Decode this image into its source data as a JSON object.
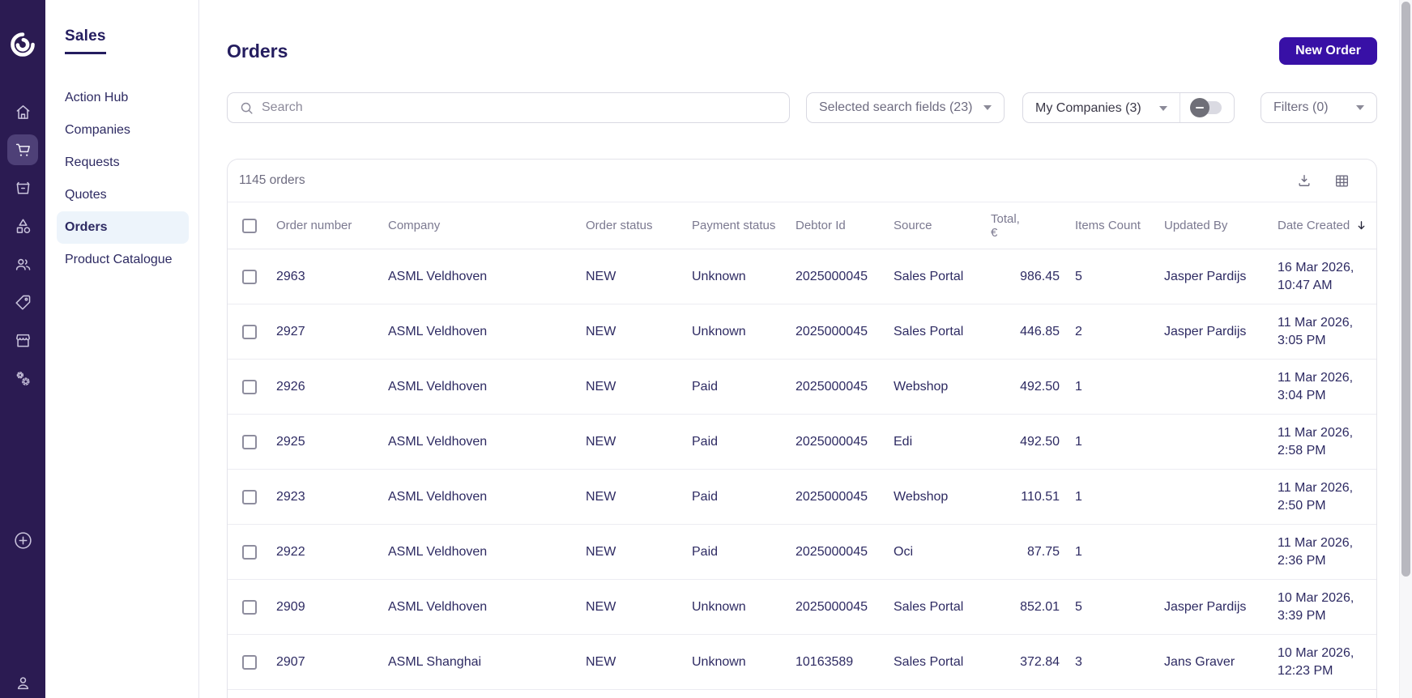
{
  "colors": {
    "rail_bg": "#2b1b52",
    "rail_selected_bg": "#4e4077",
    "accent_button": "#3810a6",
    "active_nav_bg": "#edf4fb",
    "text_dark": "#2d2a62",
    "text_muted": "#6e6c80",
    "header_gray": "#7b7990",
    "border": "#e3e3ea"
  },
  "rail": {
    "icons": [
      "app-logo",
      "home-icon",
      "cart-icon",
      "products-box-icon",
      "category-icon",
      "customers-icon",
      "tag-icon",
      "storefront-icon",
      "settings-gears-icon",
      "plus-circle-icon",
      "account-person-icon"
    ],
    "active_icon": "cart-icon"
  },
  "sidebar": {
    "title": "Sales",
    "items": [
      {
        "label": "Action Hub",
        "active": false
      },
      {
        "label": "Companies",
        "active": false
      },
      {
        "label": "Requests",
        "active": false
      },
      {
        "label": "Quotes",
        "active": false
      },
      {
        "label": "Orders",
        "active": true
      },
      {
        "label": "Product Catalogue",
        "active": false
      }
    ]
  },
  "page": {
    "title": "Orders",
    "new_order_button": "New Order"
  },
  "toolbar": {
    "search_placeholder": "Search",
    "search_fields_dropdown": "Selected search fields (23)",
    "companies_dropdown": "My Companies (3)",
    "companies_toggle_state": "off",
    "filters_dropdown": "Filters (0)"
  },
  "table": {
    "count": "1145 orders",
    "columns": [
      "Order number",
      "Company",
      "Order status",
      "Payment status",
      "Debtor Id",
      "Source",
      "Total, €",
      "Items Count",
      "Updated By",
      "Date Created"
    ],
    "sorted_by": "Date Created",
    "sort_direction": "desc",
    "rows": [
      {
        "order_number": "2963",
        "company": "ASML Veldhoven",
        "order_status": "NEW",
        "payment_status": "Unknown",
        "debtor_id": "2025000045",
        "source": "Sales Portal",
        "total": "986.45",
        "items_count": "5",
        "updated_by": "Jasper Pardijs",
        "date_line1": "16 Mar 2026,",
        "date_line2": "10:47 AM"
      },
      {
        "order_number": "2927",
        "company": "ASML Veldhoven",
        "order_status": "NEW",
        "payment_status": "Unknown",
        "debtor_id": "2025000045",
        "source": "Sales Portal",
        "total": "446.85",
        "items_count": "2",
        "updated_by": "Jasper Pardijs",
        "date_line1": "11 Mar 2026,",
        "date_line2": "3:05 PM"
      },
      {
        "order_number": "2926",
        "company": "ASML Veldhoven",
        "order_status": "NEW",
        "payment_status": "Paid",
        "debtor_id": "2025000045",
        "source": "Webshop",
        "total": "492.50",
        "items_count": "1",
        "updated_by": "",
        "date_line1": "11 Mar 2026,",
        "date_line2": "3:04 PM"
      },
      {
        "order_number": "2925",
        "company": "ASML Veldhoven",
        "order_status": "NEW",
        "payment_status": "Paid",
        "debtor_id": "2025000045",
        "source": "Edi",
        "total": "492.50",
        "items_count": "1",
        "updated_by": "",
        "date_line1": "11 Mar 2026,",
        "date_line2": "2:58 PM"
      },
      {
        "order_number": "2923",
        "company": "ASML Veldhoven",
        "order_status": "NEW",
        "payment_status": "Paid",
        "debtor_id": "2025000045",
        "source": "Webshop",
        "total": "110.51",
        "items_count": "1",
        "updated_by": "",
        "date_line1": "11 Mar 2026,",
        "date_line2": "2:50 PM"
      },
      {
        "order_number": "2922",
        "company": "ASML Veldhoven",
        "order_status": "NEW",
        "payment_status": "Paid",
        "debtor_id": "2025000045",
        "source": "Oci",
        "total": "87.75",
        "items_count": "1",
        "updated_by": "",
        "date_line1": "11 Mar 2026,",
        "date_line2": "2:36 PM"
      },
      {
        "order_number": "2909",
        "company": "ASML Veldhoven",
        "order_status": "NEW",
        "payment_status": "Unknown",
        "debtor_id": "2025000045",
        "source": "Sales Portal",
        "total": "852.01",
        "items_count": "5",
        "updated_by": "Jasper Pardijs",
        "date_line1": "10 Mar 2026,",
        "date_line2": "3:39 PM"
      },
      {
        "order_number": "2907",
        "company": "ASML Shanghai",
        "order_status": "NEW",
        "payment_status": "Unknown",
        "debtor_id": "10163589",
        "source": "Sales Portal",
        "total": "372.84",
        "items_count": "3",
        "updated_by": "Jans Graver",
        "date_line1": "10 Mar 2026,",
        "date_line2": "12:23 PM"
      }
    ]
  }
}
